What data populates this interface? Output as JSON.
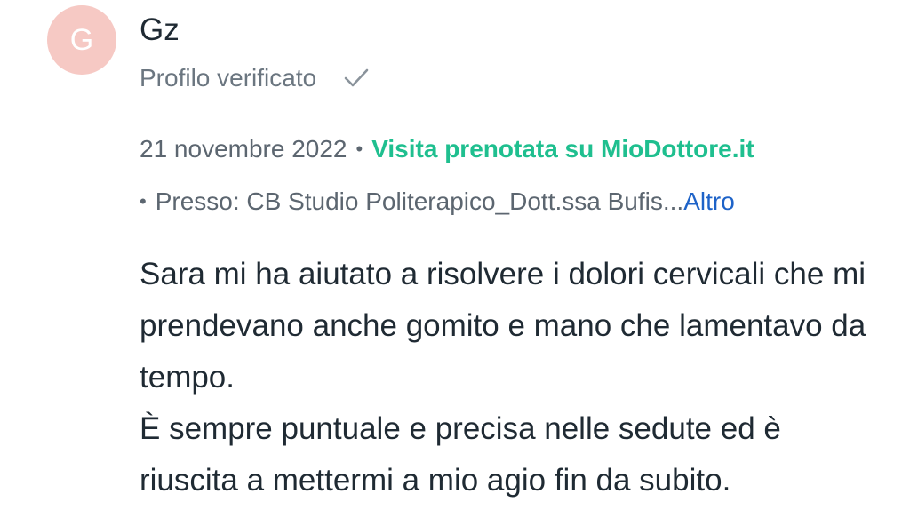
{
  "review": {
    "avatar_initial": "G",
    "author_name": "Gz",
    "verified_label": "Profilo verificato",
    "date": "21 novembre 2022",
    "separator": "•",
    "booked_label": "Visita prenotata su MioDottore.it",
    "location_bullet": "•",
    "location_text": "Presso: CB Studio Politerapico_Dott.ssa Bufis...",
    "more_label": "Altro",
    "body_line1": "Sara mi ha aiutato a risolvere i dolori cervicali che mi prendevano anche gomito e mano che lamentavo da tempo.",
    "body_line2": "È sempre puntuale e precisa nelle sedute ed è riuscita a mettermi a mio agio fin da subito."
  },
  "colors": {
    "avatar_bg": "#f6c9c4",
    "booked_green": "#1fbf8f",
    "link_blue": "#1e63c8",
    "muted_text": "#6b7680"
  },
  "icons": {
    "verified": "check-icon"
  }
}
